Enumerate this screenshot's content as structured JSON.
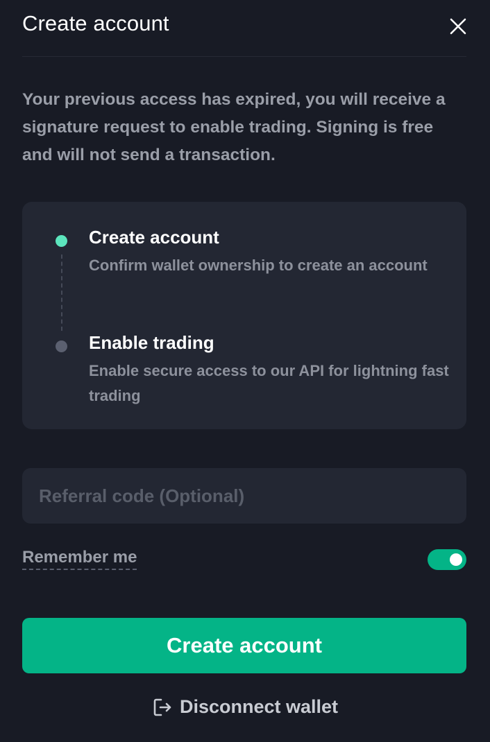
{
  "modal": {
    "title": "Create account",
    "close_icon": "close-icon",
    "description": "Your previous access has expired, you will receive a signature request to enable trading. Signing is free and will not send a transaction."
  },
  "steps": [
    {
      "title": "Create account",
      "description": "Confirm wallet ownership to create an account",
      "status": "active",
      "color": "#5ce5bd"
    },
    {
      "title": "Enable trading",
      "description": "Enable secure access to our API for lightning fast trading",
      "status": "pending",
      "color": "#5b6070"
    }
  ],
  "referral": {
    "value": "",
    "placeholder": "Referral code (Optional)"
  },
  "remember": {
    "label": "Remember me",
    "enabled": true
  },
  "actions": {
    "create_label": "Create account",
    "disconnect_label": "Disconnect wallet",
    "disconnect_icon": "logout-icon"
  },
  "colors": {
    "background": "#181b25",
    "card": "#232733",
    "accent": "#04b487"
  }
}
